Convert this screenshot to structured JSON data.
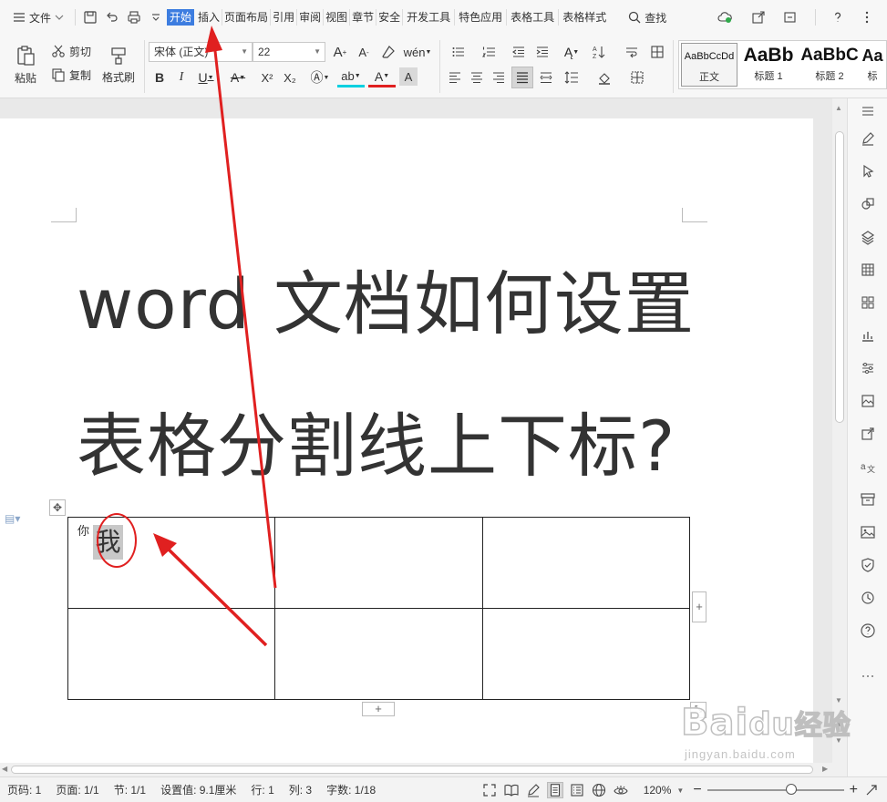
{
  "menubar": {
    "file_label": "文件",
    "tabs": [
      "开始",
      "插入",
      "页面布局",
      "引用",
      "审阅",
      "视图",
      "章节",
      "安全",
      "开发工具",
      "特色应用",
      "表格工具",
      "表格样式"
    ],
    "search_label": "查找"
  },
  "ribbon": {
    "paste_label": "粘贴",
    "cut_label": "剪切",
    "copy_label": "复制",
    "format_painter_label": "格式刷",
    "font_name": "宋体 (正文)",
    "font_size": "22",
    "bold_label": "B",
    "italic_label": "I",
    "underline_label": "U",
    "superscript_label": "X²",
    "subscript_label": "X₂",
    "styles": [
      {
        "sample": "AaBbCcDd",
        "caption": "正文"
      },
      {
        "sample": "AaBb",
        "caption": "标题 1"
      },
      {
        "sample": "AaBbC",
        "caption": "标题 2"
      },
      {
        "sample": "Aa",
        "caption": "标"
      }
    ]
  },
  "document": {
    "title_line1": "word 文档如何设置",
    "title_line2": "表格分割线上下标?",
    "cell_small_text": "你",
    "cell_big_text": "我"
  },
  "statusbar": {
    "page_no": "页码: 1",
    "pages": "页面: 1/1",
    "section": "节: 1/1",
    "setting_value": "设置值: 9.1厘米",
    "row": "行: 1",
    "col": "列: 3",
    "word_count": "字数: 1/18",
    "zoom": "120%"
  },
  "watermark": {
    "brand": "Bai",
    "brand2": "du",
    "brand3": "经验",
    "url": "jingyan.baidu.com"
  },
  "colors": {
    "accent": "#3d7de0",
    "annotation": "#e02020"
  }
}
